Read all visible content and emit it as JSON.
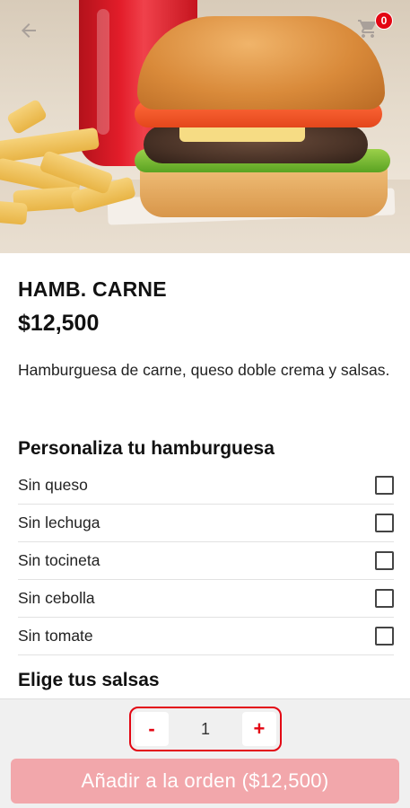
{
  "header": {
    "back_icon": "arrow-left-icon",
    "cart_icon": "shopping-cart-icon",
    "cart_count": "0"
  },
  "product": {
    "name": "HAMB. CARNE",
    "price": "$12,500",
    "description": "Hamburguesa de carne, queso doble crema y salsas."
  },
  "customize": {
    "title": "Personaliza tu hamburguesa",
    "options": [
      {
        "label": "Sin queso",
        "checked": false
      },
      {
        "label": "Sin lechuga",
        "checked": false
      },
      {
        "label": "Sin tocineta",
        "checked": false
      },
      {
        "label": "Sin cebolla",
        "checked": false
      },
      {
        "label": "Sin tomate",
        "checked": false
      }
    ]
  },
  "sauces": {
    "title": "Elige tus salsas"
  },
  "order": {
    "minus_label": "-",
    "quantity": "1",
    "plus_label": "+",
    "add_label": "Añadir a la orden ($12,500)"
  },
  "colors": {
    "accent": "#e30613",
    "add_button_bg": "#f2a7ab"
  }
}
